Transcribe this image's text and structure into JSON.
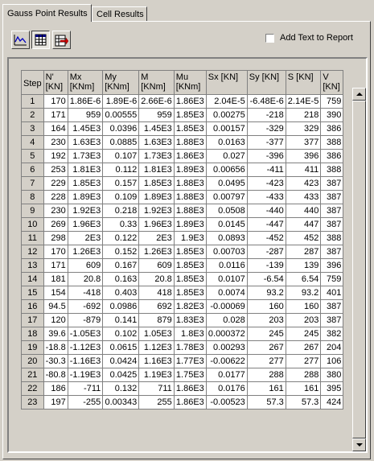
{
  "tabs": [
    {
      "label": "Gauss Point Results",
      "active": true
    },
    {
      "label": "Cell Results",
      "active": false
    }
  ],
  "toolbar": {
    "chart_icon": "chart-icon",
    "table_icon": "table-icon",
    "export_icon": "export-icon",
    "table_pressed": true,
    "add_text_label": "Add Text to Report",
    "add_text_checked": false
  },
  "table": {
    "headers": [
      [
        "Step"
      ],
      [
        "N'",
        "[KN]"
      ],
      [
        "Mx",
        "[KNm]"
      ],
      [
        "My",
        "[KNm]"
      ],
      [
        "M",
        "[KNm]"
      ],
      [
        "Mu",
        "[KNm]"
      ],
      [
        "Sx [KN]"
      ],
      [
        "Sy [KN]"
      ],
      [
        "S [KN]"
      ],
      [
        "V",
        "[KN]"
      ]
    ],
    "rows": [
      [
        "1",
        "170",
        "1.86E-6",
        "1.89E-6",
        "2.66E-6",
        "1.86E3",
        "2.04E-5",
        "-6.48E-6",
        "2.14E-5",
        "759"
      ],
      [
        "2",
        "171",
        "959",
        "0.00555",
        "959",
        "1.85E3",
        "0.00275",
        "-218",
        "218",
        "390"
      ],
      [
        "3",
        "164",
        "1.45E3",
        "0.0396",
        "1.45E3",
        "1.85E3",
        "0.00157",
        "-329",
        "329",
        "386"
      ],
      [
        "4",
        "230",
        "1.63E3",
        "0.0885",
        "1.63E3",
        "1.88E3",
        "0.0163",
        "-377",
        "377",
        "388"
      ],
      [
        "5",
        "192",
        "1.73E3",
        "0.107",
        "1.73E3",
        "1.86E3",
        "0.027",
        "-396",
        "396",
        "386"
      ],
      [
        "6",
        "253",
        "1.81E3",
        "0.112",
        "1.81E3",
        "1.89E3",
        "0.00656",
        "-411",
        "411",
        "388"
      ],
      [
        "7",
        "229",
        "1.85E3",
        "0.157",
        "1.85E3",
        "1.88E3",
        "0.0495",
        "-423",
        "423",
        "387"
      ],
      [
        "8",
        "228",
        "1.89E3",
        "0.109",
        "1.89E3",
        "1.88E3",
        "0.00797",
        "-433",
        "433",
        "387"
      ],
      [
        "9",
        "230",
        "1.92E3",
        "0.218",
        "1.92E3",
        "1.88E3",
        "0.0508",
        "-440",
        "440",
        "387"
      ],
      [
        "10",
        "269",
        "1.96E3",
        "0.33",
        "1.96E3",
        "1.89E3",
        "0.0145",
        "-447",
        "447",
        "387"
      ],
      [
        "11",
        "298",
        "2E3",
        "0.122",
        "2E3",
        "1.9E3",
        "0.0893",
        "-452",
        "452",
        "388"
      ],
      [
        "12",
        "170",
        "1.26E3",
        "0.152",
        "1.26E3",
        "1.85E3",
        "0.00703",
        "-287",
        "287",
        "387"
      ],
      [
        "13",
        "171",
        "609",
        "0.167",
        "609",
        "1.85E3",
        "0.0116",
        "-139",
        "139",
        "396"
      ],
      [
        "14",
        "181",
        "20.8",
        "0.163",
        "20.8",
        "1.85E3",
        "0.0107",
        "-6.54",
        "6.54",
        "759"
      ],
      [
        "15",
        "154",
        "-418",
        "0.403",
        "418",
        "1.85E3",
        "0.0074",
        "93.2",
        "93.2",
        "401"
      ],
      [
        "16",
        "94.5",
        "-692",
        "0.0986",
        "692",
        "1.82E3",
        "-0.00069",
        "160",
        "160",
        "387"
      ],
      [
        "17",
        "120",
        "-879",
        "0.141",
        "879",
        "1.83E3",
        "0.028",
        "203",
        "203",
        "387"
      ],
      [
        "18",
        "39.6",
        "-1.05E3",
        "0.102",
        "1.05E3",
        "1.8E3",
        "0.000372",
        "245",
        "245",
        "382"
      ],
      [
        "19",
        "-18.8",
        "-1.12E3",
        "0.0615",
        "1.12E3",
        "1.78E3",
        "0.00293",
        "267",
        "267",
        "204"
      ],
      [
        "20",
        "-30.3",
        "-1.16E3",
        "0.0424",
        "1.16E3",
        "1.77E3",
        "-0.00622",
        "277",
        "277",
        "106"
      ],
      [
        "21",
        "-80.8",
        "-1.19E3",
        "0.0425",
        "1.19E3",
        "1.75E3",
        "0.0177",
        "288",
        "288",
        "380"
      ],
      [
        "22",
        "186",
        "-711",
        "0.132",
        "711",
        "1.86E3",
        "0.0176",
        "161",
        "161",
        "395"
      ],
      [
        "23",
        "197",
        "-255",
        "0.00343",
        "255",
        "1.86E3",
        "-0.00523",
        "57.3",
        "57.3",
        "424"
      ]
    ]
  },
  "scrollbar": {
    "up_icon": "arrow-up-icon",
    "down_icon": "arrow-down-icon"
  }
}
